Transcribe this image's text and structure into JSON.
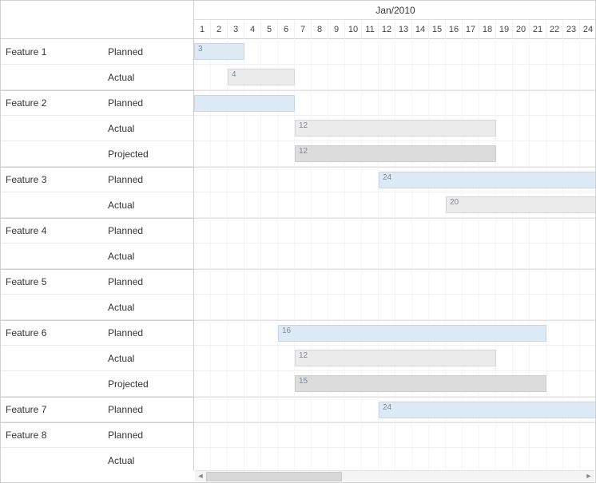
{
  "timescale": {
    "month_label": "Jan/2010",
    "days": [
      "1",
      "2",
      "3",
      "4",
      "5",
      "6",
      "7",
      "8",
      "9",
      "10",
      "11",
      "12",
      "13",
      "14",
      "15",
      "16",
      "17",
      "18",
      "19",
      "20",
      "21",
      "22",
      "23",
      "24"
    ]
  },
  "features": [
    {
      "name": "Feature 1",
      "rows": [
        {
          "type": "Planned",
          "bar": {
            "start": 1,
            "span": 3,
            "label": "3",
            "kind": "planned"
          }
        },
        {
          "type": "Actual",
          "bar": {
            "start": 3,
            "span": 4,
            "label": "4",
            "kind": "actual"
          }
        }
      ]
    },
    {
      "name": "Feature 2",
      "rows": [
        {
          "type": "Planned",
          "bar": {
            "start": 1,
            "span": 6,
            "label": "",
            "kind": "planned"
          }
        },
        {
          "type": "Actual",
          "bar": {
            "start": 7,
            "span": 12,
            "label": "12",
            "kind": "actual"
          }
        },
        {
          "type": "Projected",
          "bar": {
            "start": 7,
            "span": 12,
            "label": "12",
            "kind": "projected"
          }
        }
      ]
    },
    {
      "name": "Feature 3",
      "rows": [
        {
          "type": "Planned",
          "bar": {
            "start": 12,
            "span": 24,
            "label": "24",
            "kind": "planned"
          }
        },
        {
          "type": "Actual",
          "bar": {
            "start": 16,
            "span": 20,
            "label": "20",
            "kind": "actual"
          }
        }
      ]
    },
    {
      "name": "Feature 4",
      "rows": [
        {
          "type": "Planned",
          "bar": null
        },
        {
          "type": "Actual",
          "bar": null
        }
      ]
    },
    {
      "name": "Feature 5",
      "rows": [
        {
          "type": "Planned",
          "bar": null
        },
        {
          "type": "Actual",
          "bar": null
        }
      ]
    },
    {
      "name": "Feature 6",
      "rows": [
        {
          "type": "Planned",
          "bar": {
            "start": 6,
            "span": 16,
            "label": "16",
            "kind": "planned"
          }
        },
        {
          "type": "Actual",
          "bar": {
            "start": 7,
            "span": 12,
            "label": "12",
            "kind": "actual"
          }
        },
        {
          "type": "Projected",
          "bar": {
            "start": 7,
            "span": 15,
            "label": "15",
            "kind": "projected"
          }
        }
      ]
    },
    {
      "name": "Feature 7",
      "rows": [
        {
          "type": "Planned",
          "bar": {
            "start": 12,
            "span": 24,
            "label": "24",
            "kind": "planned"
          }
        }
      ]
    },
    {
      "name": "Feature 8",
      "rows": [
        {
          "type": "Planned",
          "bar": null
        },
        {
          "type": "Actual",
          "bar": null
        }
      ]
    }
  ],
  "scroll": {
    "left_arrow": "◄",
    "right_arrow": "►"
  },
  "chart_data": {
    "type": "gantt",
    "time_axis": {
      "unit": "day",
      "start": "2010-01-01",
      "visible_days": 24,
      "month": "Jan/2010"
    },
    "tasks": [
      {
        "feature": "Feature 1",
        "series": "Planned",
        "start_day": 1,
        "duration": 3
      },
      {
        "feature": "Feature 1",
        "series": "Actual",
        "start_day": 3,
        "duration": 4
      },
      {
        "feature": "Feature 2",
        "series": "Planned",
        "start_day": 1,
        "duration": 6
      },
      {
        "feature": "Feature 2",
        "series": "Actual",
        "start_day": 7,
        "duration": 12
      },
      {
        "feature": "Feature 2",
        "series": "Projected",
        "start_day": 7,
        "duration": 12
      },
      {
        "feature": "Feature 3",
        "series": "Planned",
        "start_day": 12,
        "duration": 24
      },
      {
        "feature": "Feature 3",
        "series": "Actual",
        "start_day": 16,
        "duration": 20
      },
      {
        "feature": "Feature 6",
        "series": "Planned",
        "start_day": 6,
        "duration": 16
      },
      {
        "feature": "Feature 6",
        "series": "Actual",
        "start_day": 7,
        "duration": 12
      },
      {
        "feature": "Feature 6",
        "series": "Projected",
        "start_day": 7,
        "duration": 15
      },
      {
        "feature": "Feature 7",
        "series": "Planned",
        "start_day": 12,
        "duration": 24
      }
    ]
  }
}
